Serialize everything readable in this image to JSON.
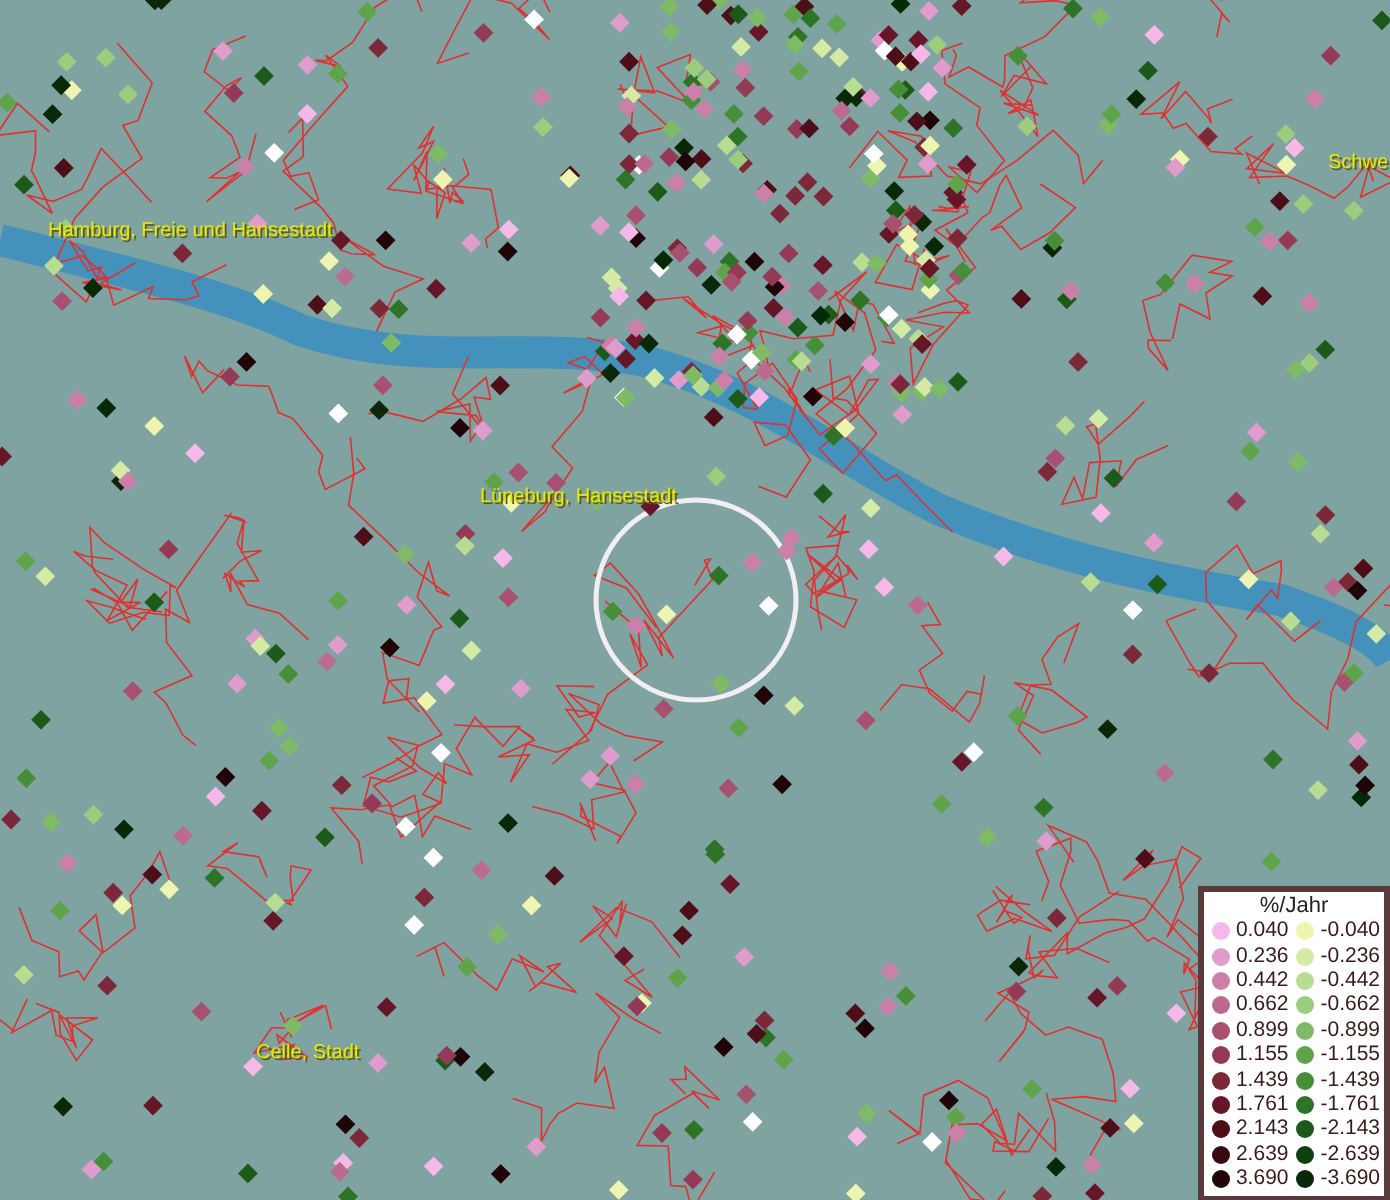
{
  "map": {
    "places": [
      {
        "name": "Hamburg, Freie und Hansestadt",
        "kind": "city"
      },
      {
        "name": "Lüneburg, Hansestadt",
        "kind": "city"
      },
      {
        "name": "Celle, Stadt",
        "kind": "city"
      },
      {
        "name": "Schwe",
        "kind": "city"
      }
    ]
  },
  "legend": {
    "title": "%/Jahr",
    "rows": [
      {
        "positive": {
          "label": "0.040",
          "color": "#f5b8e8"
        },
        "negative": {
          "label": "-0.040",
          "color": "#eef5b0"
        }
      },
      {
        "positive": {
          "label": "0.236",
          "color": "#e09ccc"
        },
        "negative": {
          "label": "-0.236",
          "color": "#d4eba6"
        }
      },
      {
        "positive": {
          "label": "0.442",
          "color": "#cc7fa8"
        },
        "negative": {
          "label": "-0.442",
          "color": "#b8dd92"
        }
      },
      {
        "positive": {
          "label": "0.662",
          "color": "#bb6b8f"
        },
        "negative": {
          "label": "-0.662",
          "color": "#9ccd7e"
        }
      },
      {
        "positive": {
          "label": "0.899",
          "color": "#a8506f"
        },
        "negative": {
          "label": "-0.899",
          "color": "#7fbb66"
        }
      },
      {
        "positive": {
          "label": "1.155",
          "color": "#943a56"
        },
        "negative": {
          "label": "-1.155",
          "color": "#5fa44a"
        }
      },
      {
        "positive": {
          "label": "1.439",
          "color": "#7d2838"
        },
        "negative": {
          "label": "-1.439",
          "color": "#468f38"
        }
      },
      {
        "positive": {
          "label": "1.761",
          "color": "#661626"
        },
        "negative": {
          "label": "-1.761",
          "color": "#2d7426"
        }
      },
      {
        "positive": {
          "label": "2.143",
          "color": "#4d0e18"
        },
        "negative": {
          "label": "-2.143",
          "color": "#1c5a1a"
        }
      },
      {
        "positive": {
          "label": "2.639",
          "color": "#380810"
        },
        "negative": {
          "label": "-2.639",
          "color": "#0f4010"
        }
      },
      {
        "positive": {
          "label": "3.690",
          "color": "#200408"
        },
        "negative": {
          "label": "-3.690",
          "color": "#082808"
        }
      }
    ]
  }
}
